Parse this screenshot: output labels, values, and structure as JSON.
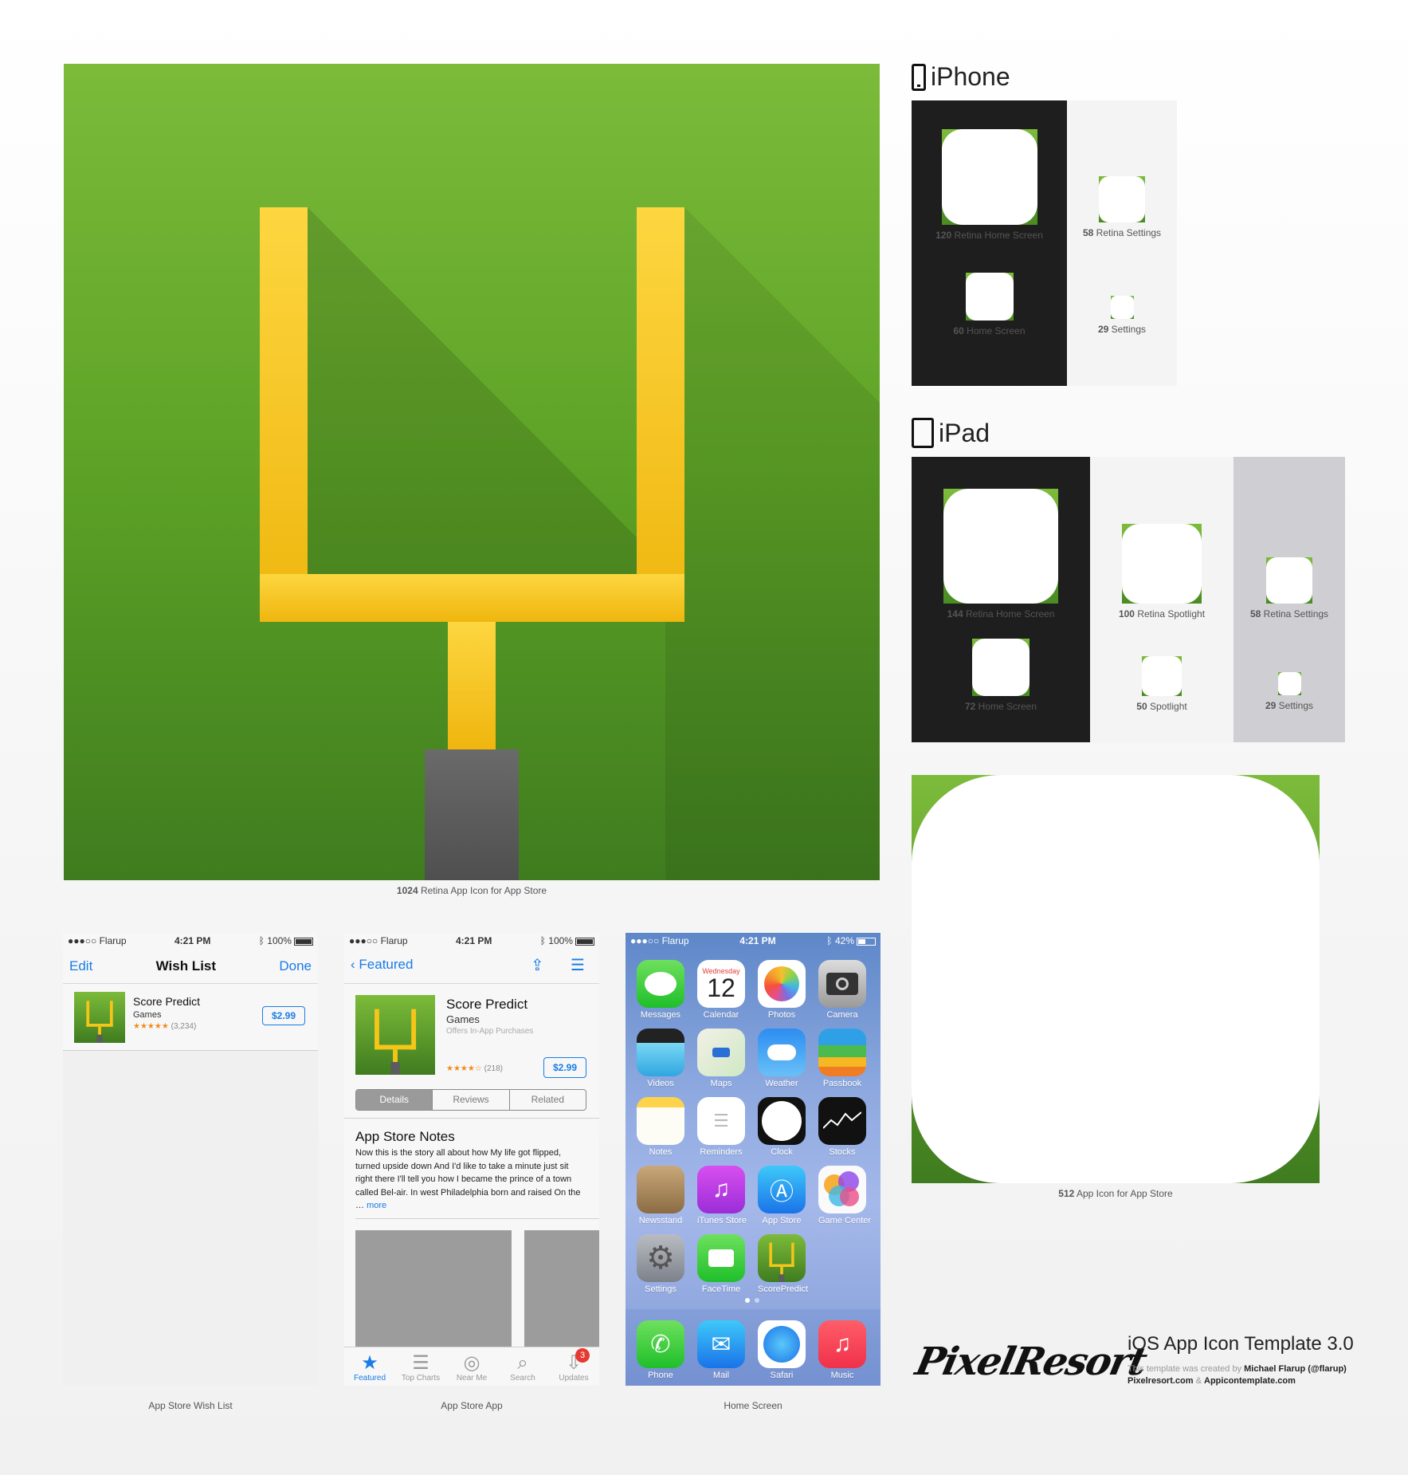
{
  "big_icon": {
    "caption_size": "1024",
    "caption_text": "Retina App Icon for App Store"
  },
  "iphone": {
    "title": "iPhone",
    "slots": [
      {
        "size": "120",
        "label": "Retina Home Screen"
      },
      {
        "size": "58",
        "label": "Retina Settings"
      },
      {
        "size": "60",
        "label": "Home Screen"
      },
      {
        "size": "29",
        "label": "Settings"
      }
    ]
  },
  "ipad": {
    "title": "iPad",
    "slots": [
      {
        "size": "144",
        "label": "Retina Home Screen"
      },
      {
        "size": "100",
        "label": "Retina Spotlight"
      },
      {
        "size": "58",
        "label": "Retina Settings"
      },
      {
        "size": "72",
        "label": "Home Screen"
      },
      {
        "size": "50",
        "label": "Spotlight"
      },
      {
        "size": "29",
        "label": "Settings"
      }
    ]
  },
  "icon512": {
    "caption_size": "512",
    "caption_text": "App Icon for App Store"
  },
  "status": {
    "carrier": "●●●○○ Flarup",
    "time": "4:21 PM",
    "battery": "100%",
    "home_battery": "42%"
  },
  "wishlist": {
    "edit": "Edit",
    "title": "Wish List",
    "done": "Done",
    "app_name": "Score Predict",
    "category": "Games",
    "stars": "★★★★★",
    "rating_count": "(3,234)",
    "price": "$2.99",
    "caption": "App Store Wish List"
  },
  "store": {
    "back": "Featured",
    "app_name": "Score Predict",
    "category": "Games",
    "iap": "Offers In-App Purchases",
    "stars": "★★★★☆",
    "rating_count": "(218)",
    "price": "$2.99",
    "tabs": [
      "Details",
      "Reviews",
      "Related"
    ],
    "notes_title": "App Store Notes",
    "notes_body": "Now this is the story all about how My life got flipped, turned upside down And I'd like to take a minute just sit right there I'll tell you how I became the prince of a town called Bel-air. In west Philadelphia born and raised On the …",
    "more": "more",
    "tabbar": [
      "Featured",
      "Top Charts",
      "Near Me",
      "Search",
      "Updates"
    ],
    "badge": "3",
    "caption": "App Store App"
  },
  "home": {
    "cal_day": "Wednesday",
    "cal_date": "12",
    "apps": [
      "Messages",
      "Calendar",
      "Photos",
      "Camera",
      "Videos",
      "Maps",
      "Weather",
      "Passbook",
      "Notes",
      "Reminders",
      "Clock",
      "Stocks",
      "Newsstand",
      "iTunes Store",
      "App Store",
      "Game Center",
      "Settings",
      "FaceTime",
      "ScorePredict"
    ],
    "dock": [
      "Phone",
      "Mail",
      "Safari",
      "Music"
    ],
    "caption": "Home Screen"
  },
  "footer": {
    "logo": "PixelResort",
    "title": "iOS App Icon Template 3.0",
    "credit_prefix": "This template was created by",
    "credit_name": "Michael Flarup (@flarup)",
    "site1": "Pixelresort.com",
    "amp": "&",
    "site2": "Appicontemplate.com"
  },
  "colors": {
    "green_top": "#7cbb3a",
    "green_bottom": "#3f7c1f",
    "goal_yellow": "#f5c518",
    "accent_blue": "#1a7ce6"
  }
}
